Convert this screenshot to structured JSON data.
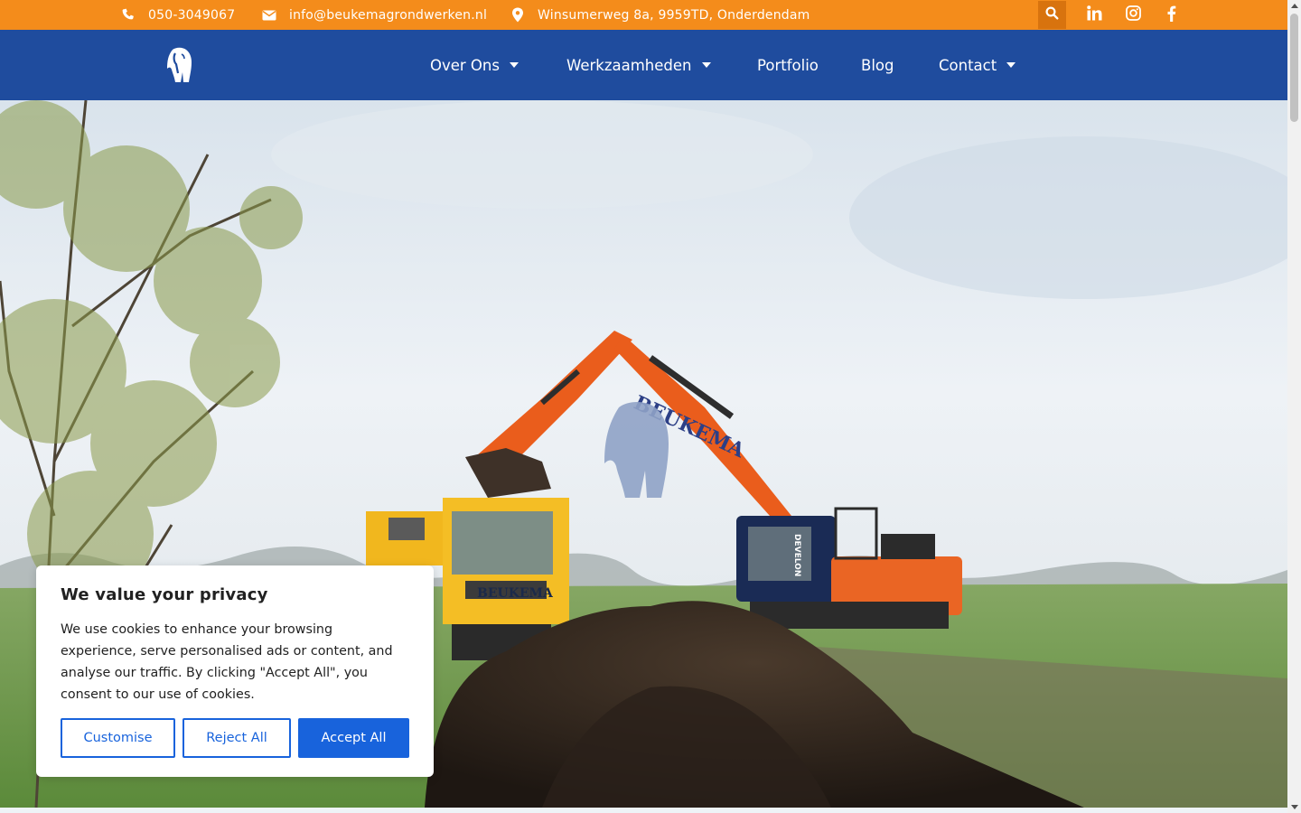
{
  "topbar": {
    "phone": "050-3049067",
    "email": "info@beukemagrondwerken.nl",
    "address": "Winsumerweg 8a, 9959TD, Onderdendam",
    "icons": {
      "phone": "phone-icon",
      "email": "envelope-icon",
      "address": "map-pin-icon",
      "search": "search-icon",
      "linkedin": "linkedin-icon",
      "instagram": "instagram-icon",
      "facebook": "facebook-icon"
    },
    "color": "#f48c1b"
  },
  "nav": {
    "color": "#1f4c9e",
    "items": [
      {
        "label": "Over Ons",
        "dropdown": true
      },
      {
        "label": "Werkzaamheden",
        "dropdown": true
      },
      {
        "label": "Portfolio",
        "dropdown": false
      },
      {
        "label": "Blog",
        "dropdown": false
      },
      {
        "label": "Contact",
        "dropdown": true
      }
    ]
  },
  "hero": {
    "machine_text_main": "BEUKEMA",
    "machine_text_truck": "BEUKEMA",
    "cab_text": "DEVELON"
  },
  "cookie": {
    "title": "We value your privacy",
    "body": "We use cookies to enhance your browsing experience, serve personalised ads or content, and analyse our traffic. By clicking \"Accept All\", you consent to our use of cookies.",
    "buttons": {
      "customise": "Customise",
      "reject": "Reject All",
      "accept": "Accept All"
    },
    "accent": "#1863dc"
  }
}
